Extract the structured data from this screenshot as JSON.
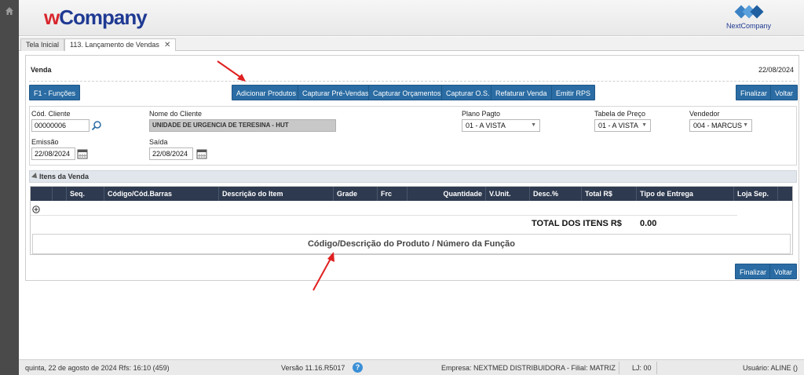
{
  "header": {
    "brand_w": "w",
    "brand_rest": "Company",
    "partner_label": "NextCompany"
  },
  "tabs": [
    {
      "label": "Tela Inicial"
    },
    {
      "label": "113. Lançamento de Vendas",
      "close": "✕"
    }
  ],
  "venda": {
    "title": "Venda",
    "date": "22/08/2024"
  },
  "toolbar": {
    "funcoes": "F1 - Funções",
    "adicionar": "Adicionar Produtos",
    "capturar_pre": "Capturar Pré-Vendas",
    "capturar_orc": "Capturar Orçamentos",
    "capturar_os": "Capturar O.S.",
    "refaturar": "Refaturar Venda",
    "emitir_rps": "Emitir RPS",
    "finalizar": "Finalizar",
    "voltar": "Voltar"
  },
  "form": {
    "cod_cliente_label": "Cód. Cliente",
    "cod_cliente_value": "00000006",
    "nome_cliente_label": "Nome do Cliente",
    "nome_cliente_value": "UNIDADE DE URGENCIA DE TERESINA - HUT",
    "plano_label": "Plano Pagto",
    "plano_value": "01 - A VISTA",
    "tabela_label": "Tabela de Preço",
    "tabela_value": "01 - A VISTA",
    "vendedor_label": "Vendedor",
    "vendedor_value": "004 - MARCUS",
    "emissao_label": "Emissão",
    "emissao_value": "22/08/2024",
    "saida_label": "Saída",
    "saida_value": "22/08/2024"
  },
  "itens": {
    "section_title": "Itens da Venda",
    "columns": [
      "",
      "",
      "Seq.",
      "Código/Cód.Barras",
      "Descrição do Item",
      "Grade",
      "Frc",
      "Quantidade",
      "V.Unit.",
      "Desc.%",
      "Total R$",
      "Tipo de Entrega",
      "Loja Sep.",
      ""
    ],
    "total_label": "TOTAL DOS ITENS R$",
    "total_value": "0.00",
    "search_hint": "Código/Descrição do Produto / Número da Função"
  },
  "bottom": {
    "finalizar": "Finalizar",
    "voltar": "Voltar"
  },
  "status": {
    "datetime": "quinta, 22 de agosto de 2024  Rfs: 16:10 (459)",
    "version": "Versão 11.16.R5017",
    "help": "?",
    "empresa": "Empresa: NEXTMED DISTRIBUIDORA - Filial: MATRIZ",
    "lj": "LJ: 00",
    "usuario": "Usuário: ALINE ()"
  },
  "colors": {
    "button_blue": "#2a6ca3",
    "grid_header": "#2e3a4f",
    "annotation_red": "#e02020"
  }
}
